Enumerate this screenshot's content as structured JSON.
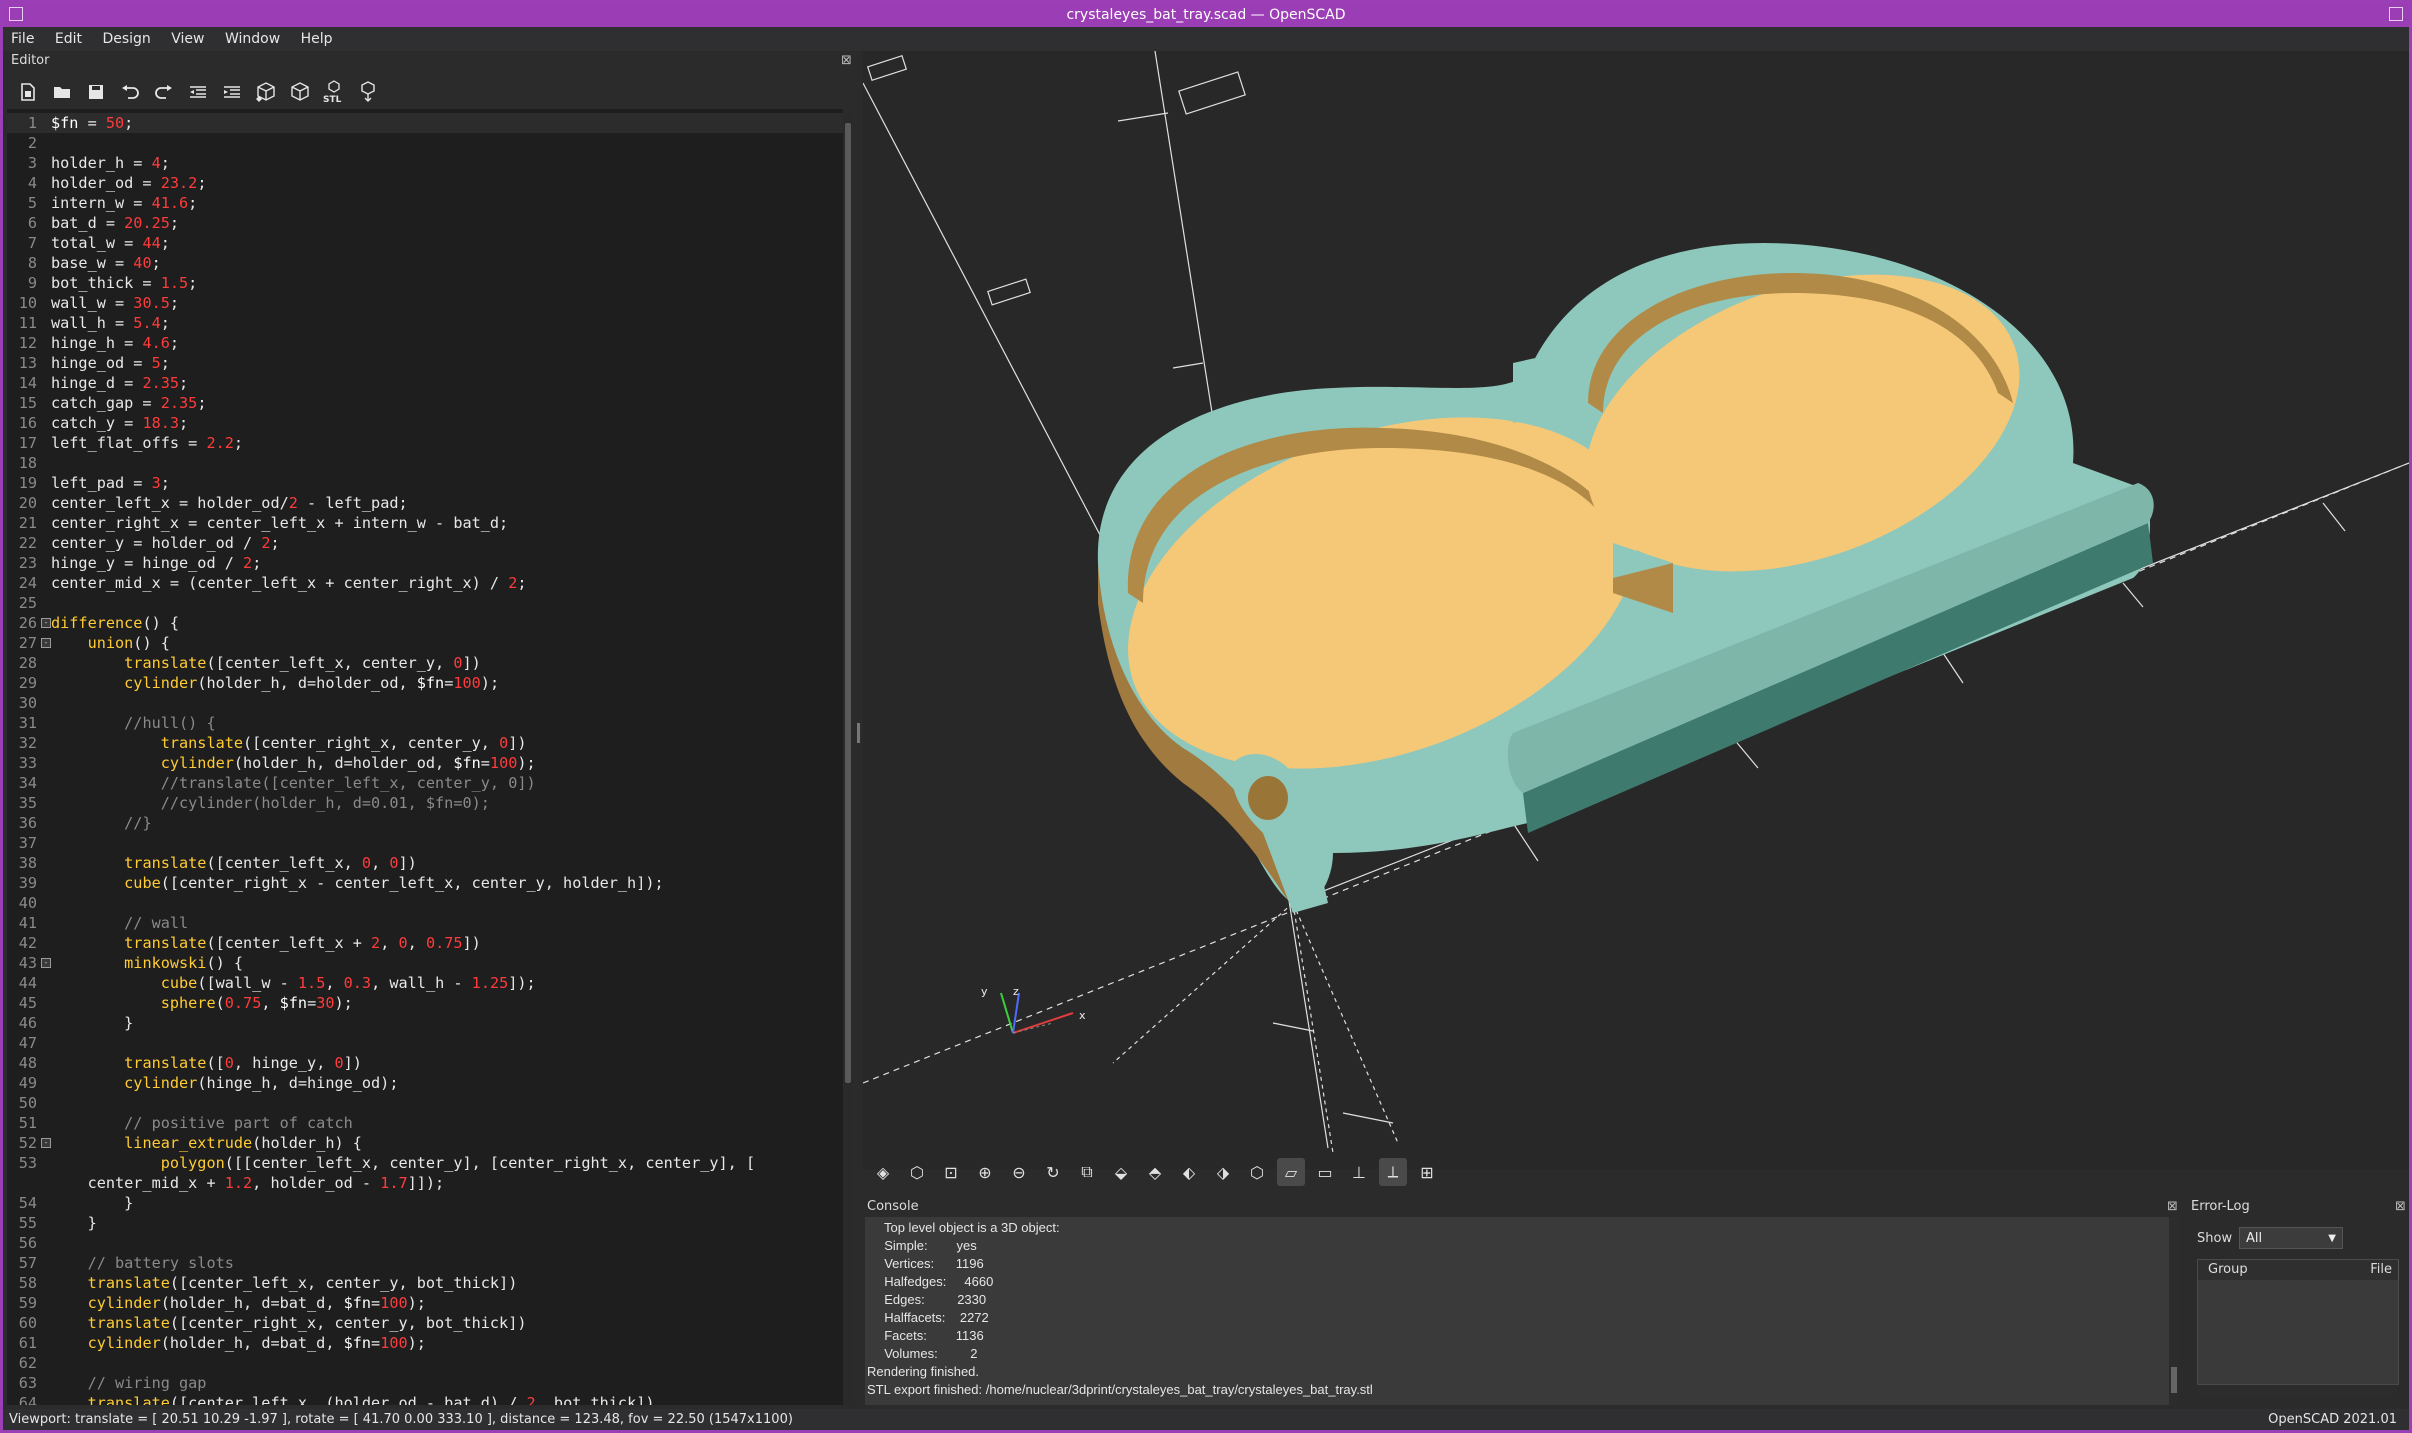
{
  "window": {
    "title": "crystaleyes_bat_tray.scad — OpenSCAD"
  },
  "menu": [
    "File",
    "Edit",
    "Design",
    "View",
    "Window",
    "Help"
  ],
  "editor": {
    "label": "Editor",
    "close": "⊠"
  },
  "toolbar": {
    "icons": [
      "new-file-icon",
      "open-file-icon",
      "save-icon",
      "undo-icon",
      "redo-icon",
      "unindent-icon",
      "indent-icon",
      "preview-icon",
      "render-icon",
      "export-stl-icon",
      "send-to-printer-icon"
    ],
    "stl_label": "STL"
  },
  "code_lines": [
    {
      "n": "1",
      "html": "<span class=\"m\">$fn</span> = <span class=\"n\">50</span>;",
      "fold": ""
    },
    {
      "n": "2",
      "html": "",
      "fold": ""
    },
    {
      "n": "3",
      "html": "holder_h = <span class=\"n\">4</span>;",
      "fold": ""
    },
    {
      "n": "4",
      "html": "holder_od = <span class=\"n\">23.2</span>;",
      "fold": ""
    },
    {
      "n": "5",
      "html": "intern_w = <span class=\"n\">41.6</span>;",
      "fold": ""
    },
    {
      "n": "6",
      "html": "bat_d = <span class=\"n\">20.25</span>;",
      "fold": ""
    },
    {
      "n": "7",
      "html": "total_w = <span class=\"n\">44</span>;",
      "fold": ""
    },
    {
      "n": "8",
      "html": "base_w = <span class=\"n\">40</span>;",
      "fold": ""
    },
    {
      "n": "9",
      "html": "bot_thick = <span class=\"n\">1.5</span>;",
      "fold": ""
    },
    {
      "n": "10",
      "html": "wall_w = <span class=\"n\">30.5</span>;",
      "fold": ""
    },
    {
      "n": "11",
      "html": "wall_h = <span class=\"n\">5.4</span>;",
      "fold": ""
    },
    {
      "n": "12",
      "html": "hinge_h = <span class=\"n\">4.6</span>;",
      "fold": ""
    },
    {
      "n": "13",
      "html": "hinge_od = <span class=\"n\">5</span>;",
      "fold": ""
    },
    {
      "n": "14",
      "html": "hinge_d = <span class=\"n\">2.35</span>;",
      "fold": ""
    },
    {
      "n": "15",
      "html": "catch_gap = <span class=\"n\">2.35</span>;",
      "fold": ""
    },
    {
      "n": "16",
      "html": "catch_y = <span class=\"n\">18.3</span>;",
      "fold": ""
    },
    {
      "n": "17",
      "html": "left_flat_offs = <span class=\"n\">2.2</span>;",
      "fold": ""
    },
    {
      "n": "18",
      "html": "",
      "fold": ""
    },
    {
      "n": "19",
      "html": "left_pad = <span class=\"n\">3</span>;",
      "fold": ""
    },
    {
      "n": "20",
      "html": "center_left_x = holder_od/<span class=\"n\">2</span> - left_pad;",
      "fold": ""
    },
    {
      "n": "21",
      "html": "center_right_x = center_left_x + intern_w - bat_d;",
      "fold": ""
    },
    {
      "n": "22",
      "html": "center_y = holder_od / <span class=\"n\">2</span>;",
      "fold": ""
    },
    {
      "n": "23",
      "html": "hinge_y = hinge_od / <span class=\"n\">2</span>;",
      "fold": ""
    },
    {
      "n": "24",
      "html": "center_mid_x = (center_left_x + center_right_x) / <span class=\"n\">2</span>;",
      "fold": ""
    },
    {
      "n": "25",
      "html": "",
      "fold": ""
    },
    {
      "n": "26",
      "html": "<span class=\"k\">difference</span>() {",
      "fold": "-"
    },
    {
      "n": "27",
      "html": "    <span class=\"k\">union</span>() {",
      "fold": "-"
    },
    {
      "n": "28",
      "html": "        <span class=\"k\">translate</span>([center_left_x, center_y, <span class=\"n\">0</span>])",
      "fold": ""
    },
    {
      "n": "29",
      "html": "        <span class=\"k\">cylinder</span>(holder_h, d=holder_od, <span class=\"m\">$fn</span>=<span class=\"n\">100</span>);",
      "fold": ""
    },
    {
      "n": "30",
      "html": "",
      "fold": ""
    },
    {
      "n": "31",
      "html": "        <span class=\"c\">//hull() {</span>",
      "fold": ""
    },
    {
      "n": "32",
      "html": "            <span class=\"k\">translate</span>([center_right_x, center_y, <span class=\"n\">0</span>])",
      "fold": ""
    },
    {
      "n": "33",
      "html": "            <span class=\"k\">cylinder</span>(holder_h, d=holder_od, <span class=\"m\">$fn</span>=<span class=\"n\">100</span>);",
      "fold": ""
    },
    {
      "n": "34",
      "html": "            <span class=\"c\">//translate([center_left_x, center_y, 0])</span>",
      "fold": ""
    },
    {
      "n": "35",
      "html": "            <span class=\"c\">//cylinder(holder_h, d=0.01, $fn=0);</span>",
      "fold": ""
    },
    {
      "n": "36",
      "html": "        <span class=\"c\">//}</span>",
      "fold": ""
    },
    {
      "n": "37",
      "html": "",
      "fold": ""
    },
    {
      "n": "38",
      "html": "        <span class=\"k\">translate</span>([center_left_x, <span class=\"n\">0</span>, <span class=\"n\">0</span>])",
      "fold": ""
    },
    {
      "n": "39",
      "html": "        <span class=\"k\">cube</span>([center_right_x - center_left_x, center_y, holder_h]);",
      "fold": ""
    },
    {
      "n": "40",
      "html": "",
      "fold": ""
    },
    {
      "n": "41",
      "html": "        <span class=\"c\">// wall</span>",
      "fold": ""
    },
    {
      "n": "42",
      "html": "        <span class=\"k\">translate</span>([center_left_x + <span class=\"n\">2</span>, <span class=\"n\">0</span>, <span class=\"n\">0.75</span>])",
      "fold": ""
    },
    {
      "n": "43",
      "html": "        <span class=\"k\">minkowski</span>() {",
      "fold": "-"
    },
    {
      "n": "44",
      "html": "            <span class=\"k\">cube</span>([wall_w - <span class=\"n\">1.5</span>, <span class=\"n\">0.3</span>, wall_h - <span class=\"n\">1.25</span>]);",
      "fold": ""
    },
    {
      "n": "45",
      "html": "            <span class=\"k\">sphere</span>(<span class=\"n\">0.75</span>, <span class=\"m\">$fn</span>=<span class=\"n\">30</span>);",
      "fold": ""
    },
    {
      "n": "46",
      "html": "        }",
      "fold": ""
    },
    {
      "n": "47",
      "html": "",
      "fold": ""
    },
    {
      "n": "48",
      "html": "        <span class=\"k\">translate</span>([<span class=\"n\">0</span>, hinge_y, <span class=\"n\">0</span>])",
      "fold": ""
    },
    {
      "n": "49",
      "html": "        <span class=\"k\">cylinder</span>(hinge_h, d=hinge_od);",
      "fold": ""
    },
    {
      "n": "50",
      "html": "",
      "fold": ""
    },
    {
      "n": "51",
      "html": "        <span class=\"c\">// positive part of catch</span>",
      "fold": ""
    },
    {
      "n": "52",
      "html": "        <span class=\"k\">linear_extrude</span>(holder_h) {",
      "fold": "-"
    },
    {
      "n": "53",
      "html": "            <span class=\"k\">polygon</span>([[center_left_x, center_y], [center_right_x, center_y], [",
      "fold": ""
    },
    {
      "n": "",
      "html": "    center_mid_x + <span class=\"n\">1.2</span>, holder_od - <span class=\"n\">1.7</span>]]);",
      "fold": ""
    },
    {
      "n": "54",
      "html": "        }",
      "fold": ""
    },
    {
      "n": "55",
      "html": "    }",
      "fold": ""
    },
    {
      "n": "56",
      "html": "",
      "fold": ""
    },
    {
      "n": "57",
      "html": "    <span class=\"c\">// battery slots</span>",
      "fold": ""
    },
    {
      "n": "58",
      "html": "    <span class=\"k\">translate</span>([center_left_x, center_y, bot_thick])",
      "fold": ""
    },
    {
      "n": "59",
      "html": "    <span class=\"k\">cylinder</span>(holder_h, d=bat_d, <span class=\"m\">$fn</span>=<span class=\"n\">100</span>);",
      "fold": ""
    },
    {
      "n": "60",
      "html": "    <span class=\"k\">translate</span>([center_right_x, center_y, bot_thick])",
      "fold": ""
    },
    {
      "n": "61",
      "html": "    <span class=\"k\">cylinder</span>(holder_h, d=bat_d, <span class=\"m\">$fn</span>=<span class=\"n\">100</span>);",
      "fold": ""
    },
    {
      "n": "62",
      "html": "",
      "fold": ""
    },
    {
      "n": "63",
      "html": "    <span class=\"c\">// wiring gap</span>",
      "fold": ""
    },
    {
      "n": "64",
      "html": "    <span class=\"k\">translate</span>([center_left_x, (holder_od - bat_d) / <span class=\"n\">2</span>, bot_thick])",
      "fold": ""
    }
  ],
  "viewport_toolbar": {
    "icons": [
      "preview-icon",
      "render-icon",
      "view-all-icon",
      "zoom-in-icon",
      "zoom-out-icon",
      "reset-view-icon",
      "view-right-icon",
      "view-top-icon",
      "view-bottom-icon",
      "view-left-icon",
      "view-front-icon",
      "view-back-icon",
      "perspective-icon",
      "orthogonal-icon",
      "show-axes-icon",
      "show-scale-icon",
      "show-edges-icon"
    ],
    "active": [
      "perspective-icon",
      "show-scale-icon"
    ]
  },
  "axes": {
    "x": "x",
    "y": "y",
    "z": "z"
  },
  "console": {
    "title": "Console",
    "lines": [
      "  Top level object is a 3D object:",
      "  Simple:        yes",
      "  Vertices:      1196",
      "  Halfedges:     4660",
      "  Edges:         2330",
      "  Halffacets:    2272",
      "  Facets:        1136",
      "  Volumes:         2",
      "Rendering finished.",
      "STL export finished: /home/nuclear/3dprint/crystaleyes_bat_tray/crystaleyes_bat_tray.stl"
    ]
  },
  "error_log": {
    "title": "Error-Log",
    "show_label": "Show",
    "show_value": "All",
    "columns": [
      "Group",
      "File"
    ]
  },
  "status": {
    "viewport": "Viewport: translate = [ 20.51 10.29 -1.97 ], rotate = [ 41.70 0.00 333.10 ], distance = 123.48, fov = 22.50 (1547x1100)",
    "version": "OpenSCAD 2021.01"
  },
  "colors": {
    "title_bar": "#9b3db4",
    "model_top": "#f5c878",
    "model_side": "#8ec7bb",
    "model_wall": "#b08a46",
    "background": "#282828"
  }
}
